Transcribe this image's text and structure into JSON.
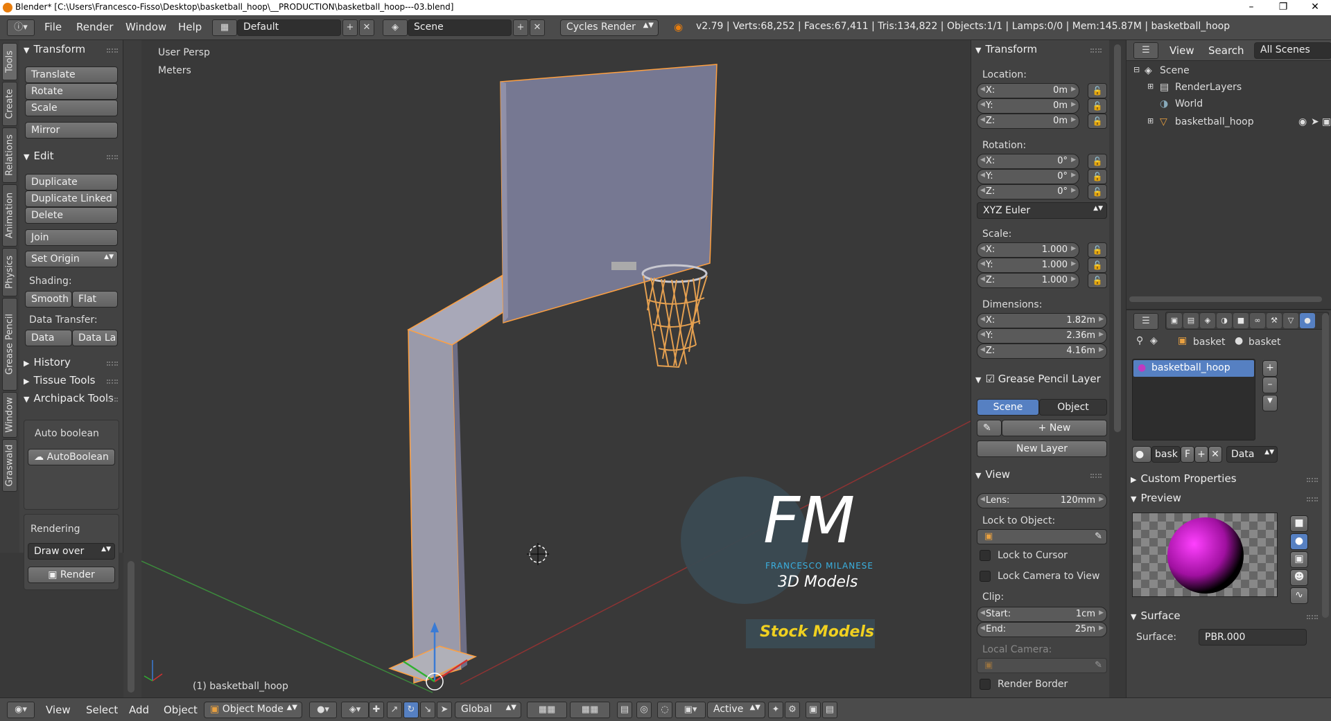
{
  "titlebar": {
    "title": "Blender* [C:\\Users\\Francesco-Fisso\\Desktop\\basketball_hoop\\__PRODUCTION\\basketball_hoop---03.blend]"
  },
  "header": {
    "menus": [
      "File",
      "Render",
      "Window",
      "Help"
    ],
    "layout": "Default",
    "scene": "Scene",
    "engine": "Cycles Render",
    "stats": "v2.79 | Verts:68,252 | Faces:67,411 | Tris:134,822 | Objects:1/1 | Lamps:0/0 | Mem:145.87M | basketball_hoop"
  },
  "tooltabs": [
    "Tools",
    "Create",
    "Relations",
    "Animation",
    "Physics",
    "Grease Pencil",
    "Window",
    "Graswald"
  ],
  "toolshelf": {
    "transform": {
      "title": "Transform",
      "buttons": [
        "Translate",
        "Rotate",
        "Scale",
        "Mirror"
      ]
    },
    "edit": {
      "title": "Edit",
      "buttons": [
        "Duplicate",
        "Duplicate Linked",
        "Delete",
        "Join"
      ],
      "set_origin": "Set Origin",
      "shading_label": "Shading:",
      "smooth": "Smooth",
      "flat": "Flat",
      "data_transfer_label": "Data Transfer:",
      "data": "Data",
      "data_la": "Data La"
    },
    "history": "History",
    "tissue": "Tissue Tools",
    "archipack": "Archipack Tools",
    "auto_boolean_label": "Auto boolean",
    "auto_boolean_btn": "AutoBoolean",
    "rendering_label": "Rendering",
    "draw_over": "Draw over",
    "render_btn": "Render"
  },
  "viewport": {
    "persp": "User Persp",
    "units": "Meters",
    "object_label": "(1) basketball_hoop",
    "watermark_fm": "FM",
    "watermark_name": "FRANCESCO MILANESE",
    "watermark_3d": "3D Models",
    "watermark_stock": "Stock Models"
  },
  "npanel": {
    "transform_title": "Transform",
    "location_label": "Location:",
    "location": {
      "x": "0m",
      "y": "0m",
      "z": "0m"
    },
    "rotation_label": "Rotation:",
    "rotation": {
      "x": "0°",
      "y": "0°",
      "z": "0°"
    },
    "rotation_mode": "XYZ Euler",
    "scale_label": "Scale:",
    "scale": {
      "x": "1.000",
      "y": "1.000",
      "z": "1.000"
    },
    "dimensions_label": "Dimensions:",
    "dimensions": {
      "x": "1.82m",
      "y": "2.36m",
      "z": "4.16m"
    },
    "axis": {
      "x": "X:",
      "y": "Y:",
      "z": "Z:"
    },
    "gp_title": "Grease Pencil Layer",
    "gp_scene": "Scene",
    "gp_object": "Object",
    "gp_new": "New",
    "gp_new_layer": "New Layer",
    "view_title": "View",
    "lens_label": "Lens:",
    "lens": "120mm",
    "lock_to_object": "Lock to Object:",
    "lock_to_cursor": "Lock to Cursor",
    "lock_camera": "Lock Camera to View",
    "clip_label": "Clip:",
    "clip_start_label": "Start:",
    "clip_start": "1cm",
    "clip_end_label": "End:",
    "clip_end": "25m",
    "local_camera": "Local Camera:",
    "render_border": "Render Border"
  },
  "outliner": {
    "view": "View",
    "search": "Search",
    "all_scenes": "All Scenes",
    "items": [
      "Scene",
      "RenderLayers",
      "World",
      "basketball_hoop"
    ]
  },
  "properties": {
    "crumb1": "basket",
    "crumb2": "basket",
    "material": "basketball_hoop",
    "mat_name": "bask",
    "mat_f": "F",
    "mat_link": "Data",
    "custom_props": "Custom Properties",
    "preview": "Preview",
    "surface_title": "Surface",
    "surface_label": "Surface:",
    "surface_value": "PBR.000"
  },
  "footer": {
    "menus": [
      "View",
      "Select",
      "Add",
      "Object"
    ],
    "mode": "Object Mode",
    "orientation": "Global",
    "pivot": "Active"
  }
}
